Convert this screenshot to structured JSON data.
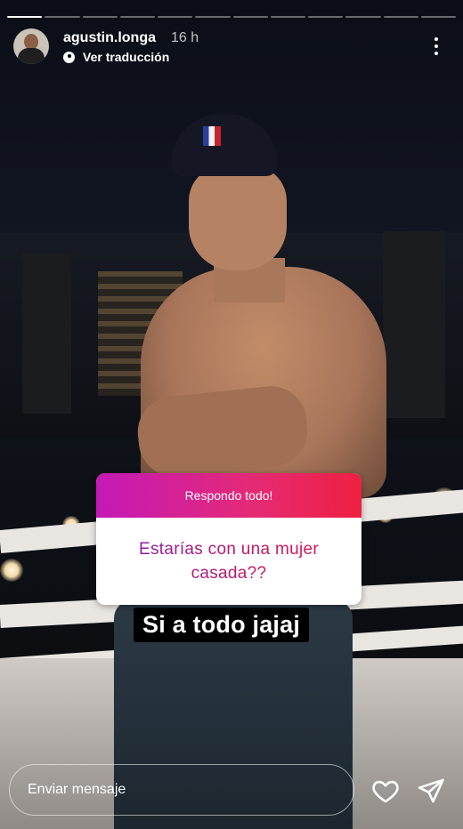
{
  "story": {
    "segments_total": 12,
    "segments_done": 1
  },
  "header": {
    "username": "agustin.longa",
    "time": "16 h",
    "translate_label": "Ver traducción",
    "avatar_icon": "user-avatar-icon",
    "menu_icon": "more-vertical-icon"
  },
  "sticker": {
    "header": "Respondo todo!",
    "question": "Estarías con una mujer casada??",
    "colors": {
      "gradient_start": "#c419b8",
      "gradient_end": "#ef2040"
    }
  },
  "answer": {
    "text": "Si a todo jajaj"
  },
  "footer": {
    "reply_placeholder": "Enviar mensaje",
    "like_icon": "heart-icon",
    "send_icon": "send-icon"
  }
}
